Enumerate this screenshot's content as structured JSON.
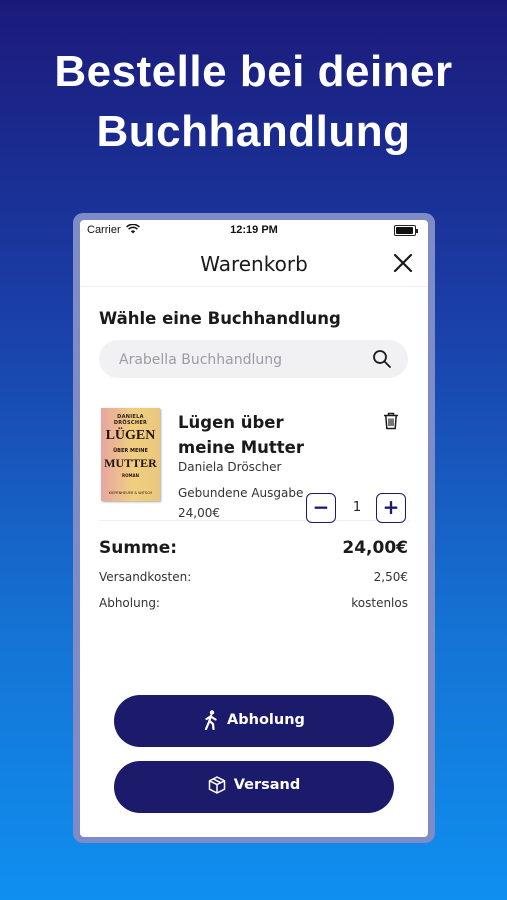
{
  "headline": {
    "line1": "Bestelle bei deiner",
    "line2": "Buchhandlung"
  },
  "statusbar": {
    "carrier": "Carrier",
    "time": "12:19 PM"
  },
  "nav": {
    "title": "Warenkorb"
  },
  "store": {
    "title": "Wähle eine Buchhandlung",
    "placeholder": "Arabella Buchhandlung"
  },
  "item": {
    "title": "Lügen über meine Mutter",
    "author": "Daniela Dröscher",
    "format": "Gebundene Ausgabe",
    "price": "24,00€",
    "quantity": "1",
    "cover": {
      "author": "DANIELA DRÖSCHER",
      "title_line1": "LÜGEN",
      "title_line2": "ÜBER MEINE",
      "title_line3": "MUTTER",
      "genre": "ROMAN",
      "publisher": "KIEPENHEUER & WITSCH"
    }
  },
  "summary": {
    "sum_label": "Summe:",
    "sum_value": "24,00€",
    "shipping_label": "Versandkosten:",
    "shipping_value": "2,50€",
    "pickup_label": "Abholung:",
    "pickup_value": "kostenlos"
  },
  "buttons": {
    "pickup": "Abholung",
    "ship": "Versand"
  },
  "colors": {
    "primary": "#1c1a6b",
    "background_top": "#1b1a7a",
    "background_bottom": "#0f8ff0"
  }
}
